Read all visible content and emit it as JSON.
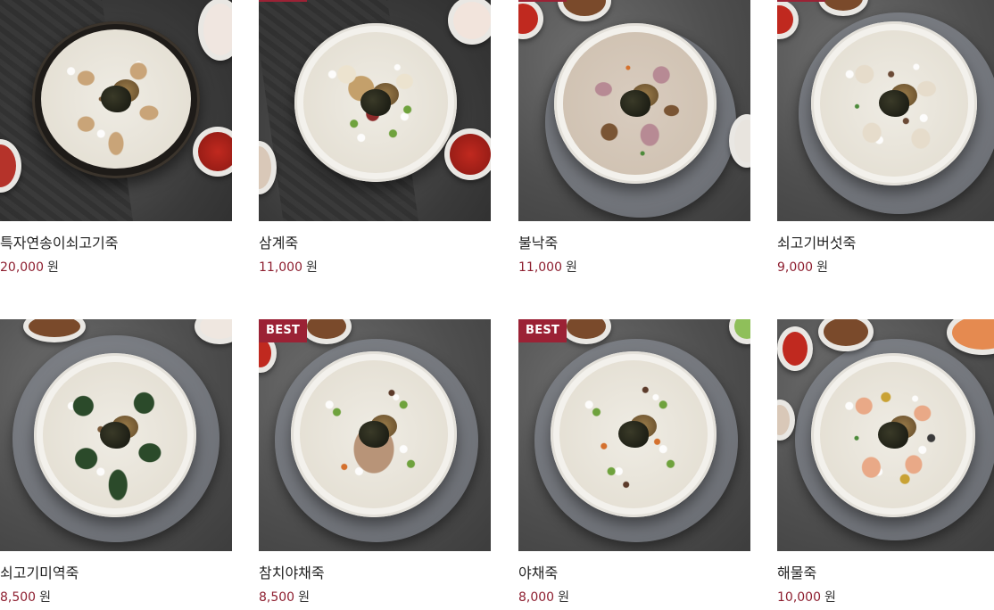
{
  "badge_label": "BEST",
  "currency_unit": "원",
  "accent_color": "#9b2235",
  "price_color": "#8e1f30",
  "products": [
    {
      "name": "특자연송이쇠고기죽",
      "price": "20,000",
      "best": false
    },
    {
      "name": "삼계죽",
      "price": "11,000",
      "best": true
    },
    {
      "name": "불낙죽",
      "price": "11,000",
      "best": true
    },
    {
      "name": "쇠고기버섯죽",
      "price": "9,000",
      "best": true
    },
    {
      "name": "쇠고기미역죽",
      "price": "8,500",
      "best": false
    },
    {
      "name": "참치야채죽",
      "price": "8,500",
      "best": true
    },
    {
      "name": "야채죽",
      "price": "8,000",
      "best": true
    },
    {
      "name": "해물죽",
      "price": "10,000",
      "best": false
    }
  ]
}
